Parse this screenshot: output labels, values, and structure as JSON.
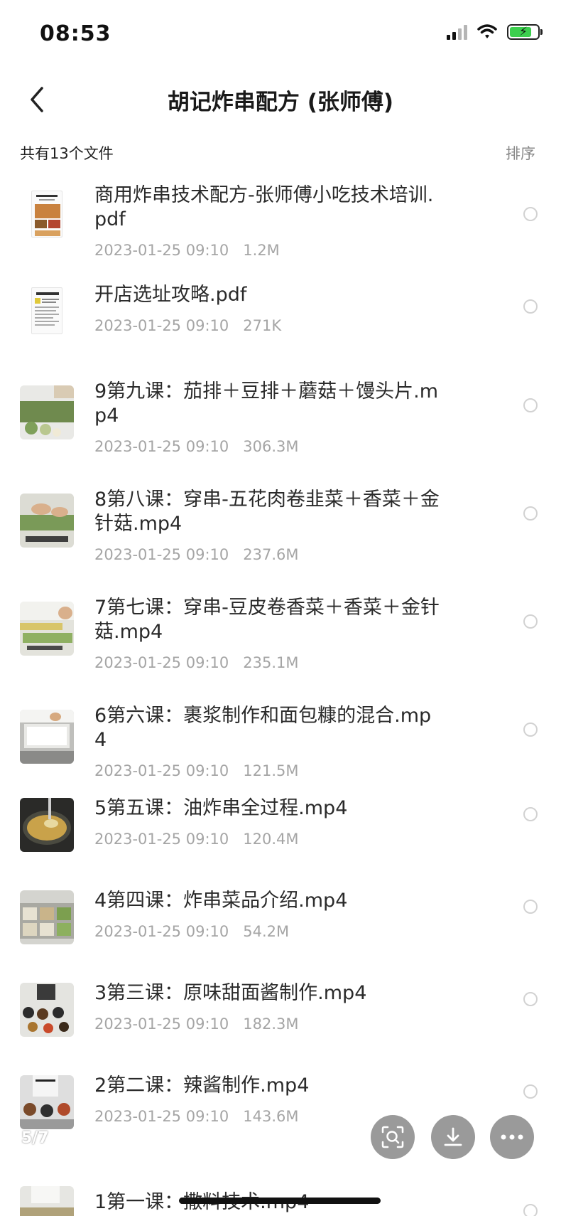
{
  "status_bar": {
    "time": "08:53"
  },
  "header": {
    "title": "胡记炸串配方 (张师傅)"
  },
  "summary": {
    "count_text": "共有13个文件",
    "sort_label": "排序"
  },
  "files": [
    {
      "name": "商用炸串技术配方-张师傅小吃技术培训.pdf",
      "date": "2023-01-25 09:10",
      "size": "1.2M",
      "type": "pdf"
    },
    {
      "name": "开店选址攻略.pdf",
      "date": "2023-01-25 09:10",
      "size": "271K",
      "type": "pdf"
    },
    {
      "name": "9第九课：茄排＋豆排＋蘑菇＋馒头片.mp4",
      "date": "2023-01-25 09:10",
      "size": "306.3M",
      "type": "video"
    },
    {
      "name": "8第八课：穿串-五花肉卷韭菜＋香菜＋金针菇.mp4",
      "date": "2023-01-25 09:10",
      "size": "237.6M",
      "type": "video"
    },
    {
      "name": "7第七课：穿串-豆皮卷香菜＋香菜＋金针菇.mp4",
      "date": "2023-01-25 09:10",
      "size": "235.1M",
      "type": "video"
    },
    {
      "name": "6第六课：裹浆制作和面包糠的混合.mp4",
      "date": "2023-01-25 09:10",
      "size": "121.5M",
      "type": "video"
    },
    {
      "name": "5第五课：油炸串全过程.mp4",
      "date": "2023-01-25 09:10",
      "size": "120.4M",
      "type": "video"
    },
    {
      "name": "4第四课：炸串菜品介绍.mp4",
      "date": "2023-01-25 09:10",
      "size": "54.2M",
      "type": "video"
    },
    {
      "name": "3第三课：原味甜面酱制作.mp4",
      "date": "2023-01-25 09:10",
      "size": "182.3M",
      "type": "video"
    },
    {
      "name": "2第二课：辣酱制作.mp4",
      "date": "2023-01-25 09:10",
      "size": "143.6M",
      "type": "video"
    },
    {
      "name": "1第一课：撒料技术.mp4",
      "date": "",
      "size": "",
      "type": "video"
    }
  ],
  "page_indicator": "5/7",
  "icons": {
    "back": "chevron-left-icon",
    "scan": "scan-search-icon",
    "download": "download-icon",
    "more": "more-dots-icon"
  },
  "colors": {
    "accent_battery": "#3ccf4e",
    "fab_background": "#9a9a9a",
    "meta_text": "#a5a5a5"
  }
}
